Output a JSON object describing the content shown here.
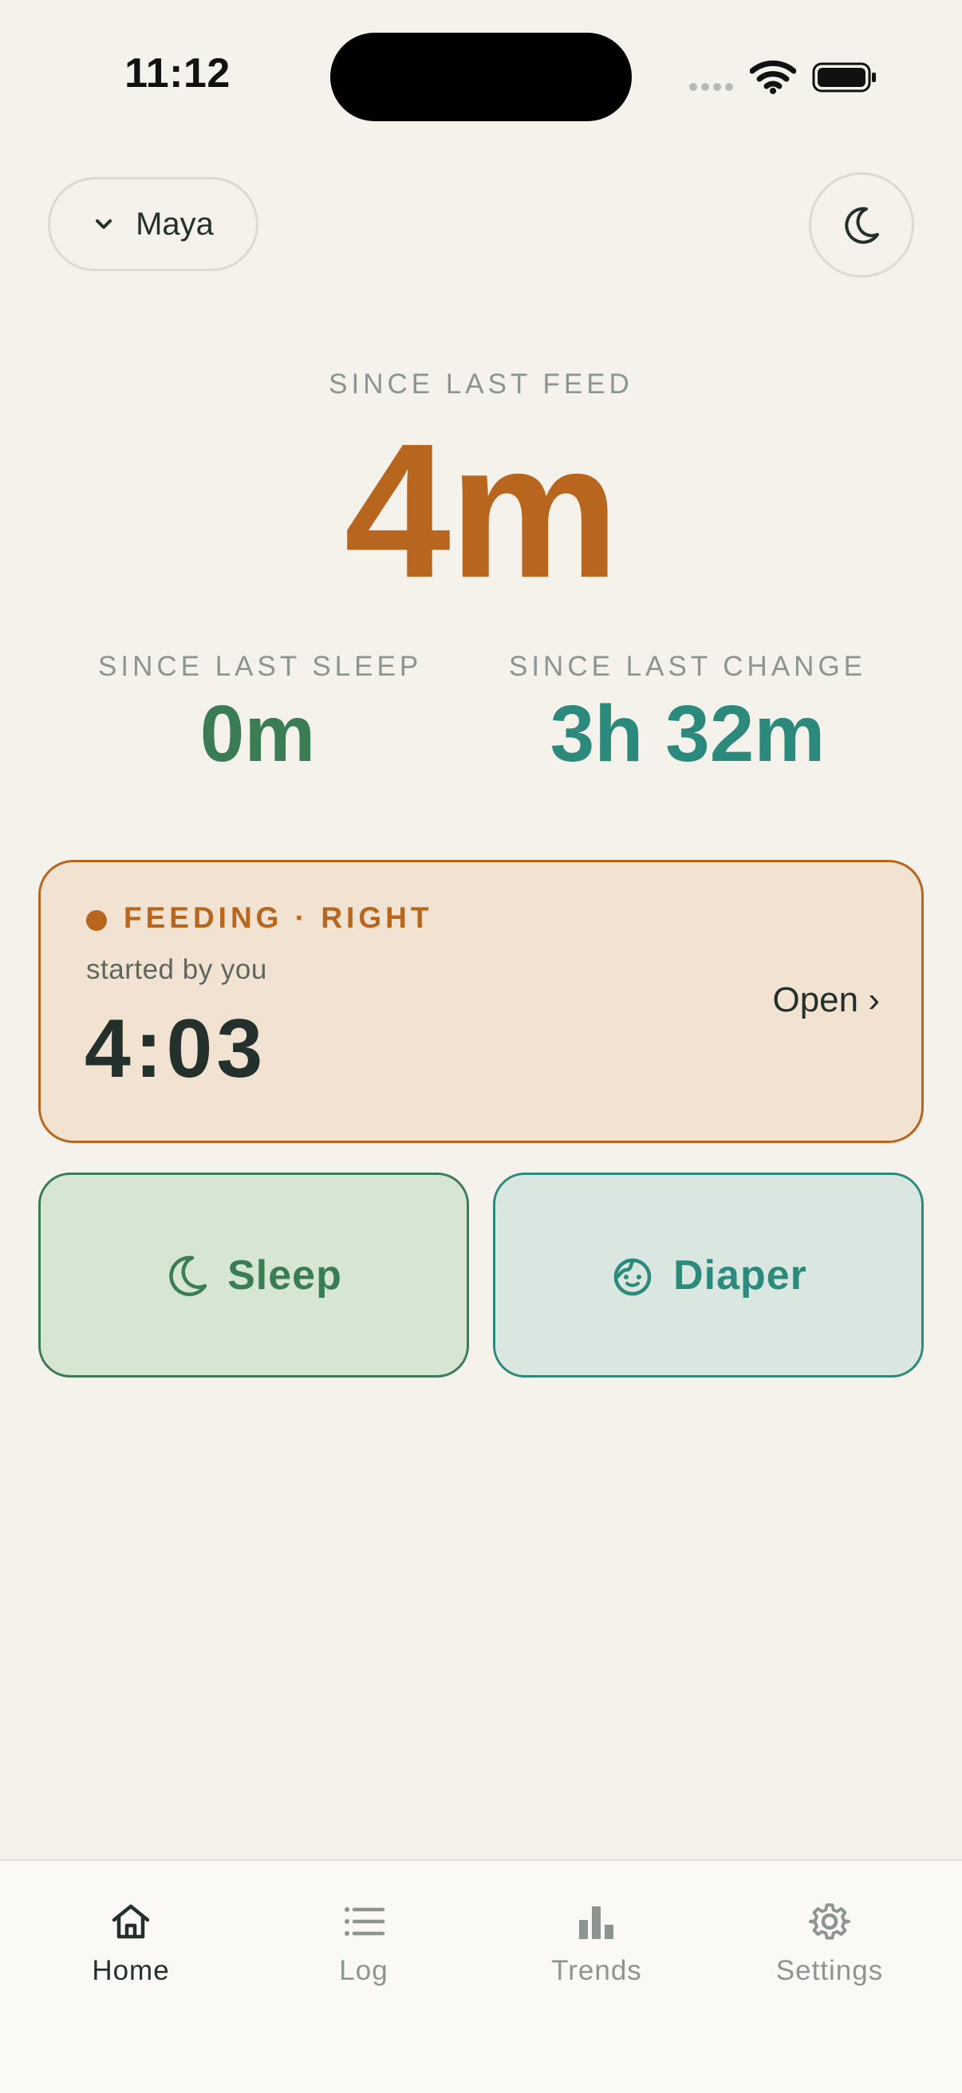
{
  "status_bar": {
    "time": "11:12"
  },
  "header": {
    "baby_name": "Maya"
  },
  "summary": {
    "feed": {
      "label": "SINCE LAST FEED",
      "value": "4m"
    },
    "sleep": {
      "label": "SINCE LAST SLEEP",
      "value": "0m"
    },
    "change": {
      "label": "SINCE LAST CHANGE",
      "value": "3h 32m"
    }
  },
  "active_session": {
    "title": "FEEDING · RIGHT",
    "subtitle": "started by you",
    "timer": "4:03",
    "open_label": "Open ›"
  },
  "actions": {
    "sleep_label": "Sleep",
    "diaper_label": "Diaper"
  },
  "nav": {
    "items": [
      {
        "label": "Home",
        "icon": "home-icon",
        "active": true
      },
      {
        "label": "Log",
        "icon": "list-icon",
        "active": false
      },
      {
        "label": "Trends",
        "icon": "bar-chart-icon",
        "active": false
      },
      {
        "label": "Settings",
        "icon": "gear-icon",
        "active": false
      }
    ]
  },
  "colors": {
    "background": "#F5F1EB",
    "feed": "#B8651E",
    "sleep": "#3A7D55",
    "change": "#2B8A7B",
    "text": "#23302B",
    "muted": "#8C958F"
  }
}
